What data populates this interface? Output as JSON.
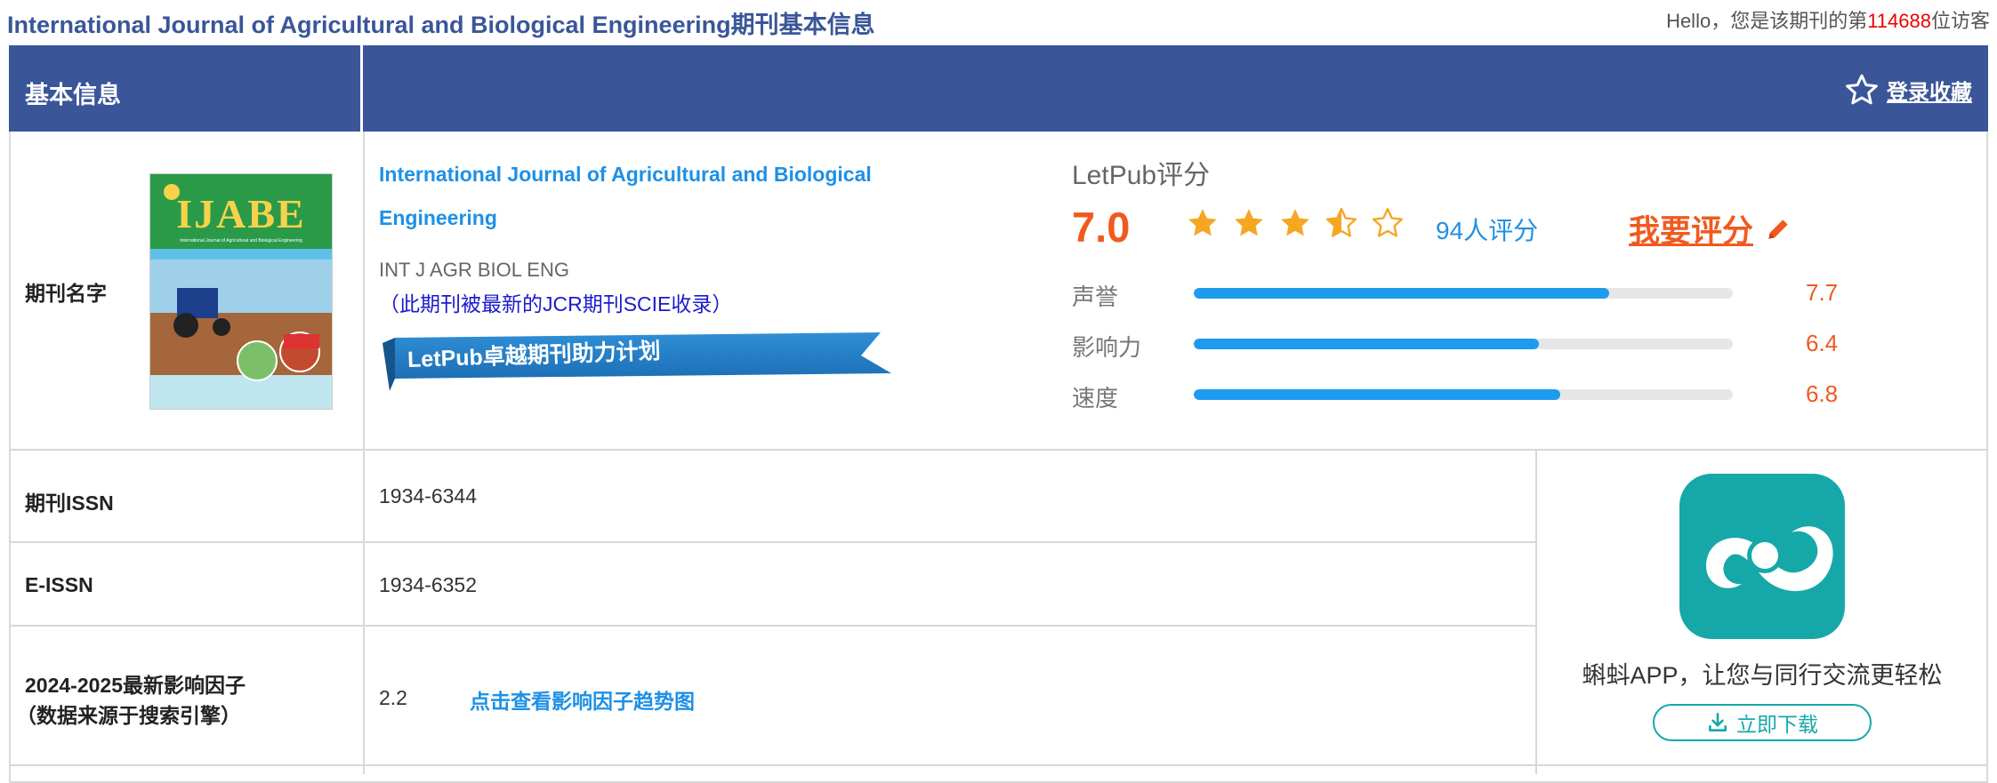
{
  "page": {
    "title": "International Journal of Agricultural and Biological Engineering期刊基本信息",
    "visitor_prefix": "Hello，您是该期刊的第",
    "visitor_number": "114688",
    "visitor_suffix": "位访客"
  },
  "header": {
    "section_label": "基本信息",
    "favorite_label": "登录收藏",
    "favorite_icon": "star-outline-icon"
  },
  "journal": {
    "row_label": "期刊名字",
    "cover": {
      "title": "IJABE",
      "subtitle": "International Journal of Agricultural and Biological Engineering"
    },
    "full_name": "International Journal of Agricultural and Biological Engineering",
    "abbr": "INT J AGR BIOL ENG",
    "jcr_note": "（此期刊被最新的JCR期刊SCIE收录）",
    "ribbon_text": "LetPub卓越期刊助力计划"
  },
  "rating": {
    "title": "LetPub评分",
    "score": "7.0",
    "stars": 3.5,
    "count_label": "94人评分",
    "rate_link": "我要评分",
    "rate_icon": "pencil-icon",
    "bars": [
      {
        "label": "声誉",
        "value": "7.7",
        "fraction": 0.77
      },
      {
        "label": "影响力",
        "value": "6.4",
        "fraction": 0.64
      },
      {
        "label": "速度",
        "value": "6.8",
        "fraction": 0.68
      }
    ],
    "colors": {
      "accent": "#f05a1e",
      "bar": "#1e9bef",
      "star": "#f5a623"
    }
  },
  "issn": {
    "label": "期刊ISSN",
    "value": "1934-6344"
  },
  "eissn": {
    "label": "E-ISSN",
    "value": "1934-6352"
  },
  "impact": {
    "label_line1": "2024-2025最新影响因子",
    "label_line2": "（数据来源于搜索引擎）",
    "value": "2.2",
    "trend_link": "点击查看影响因子趋势图"
  },
  "app": {
    "icon": "app-logo-icon",
    "text": "蝌蚪APP，让您与同行交流更轻松",
    "download_label": "立即下载",
    "download_icon": "download-icon",
    "color": "#16a8a9"
  },
  "theme": {
    "header_bg": "#3a5699",
    "link": "#1e90e6"
  }
}
